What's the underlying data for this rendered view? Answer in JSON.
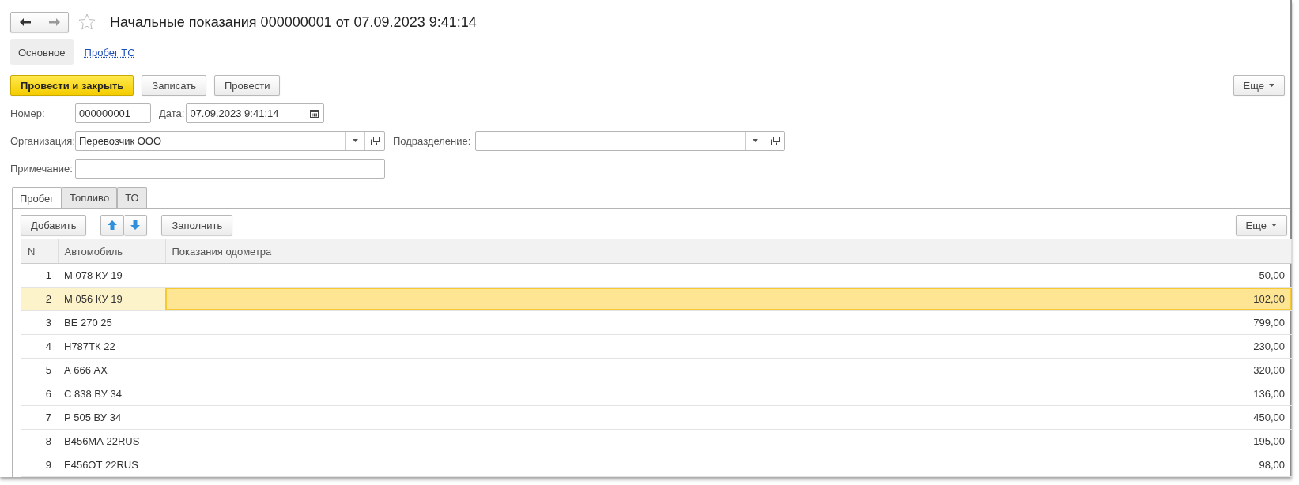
{
  "window": {
    "title": "Начальные показания 000000001 от 07.09.2023 9:41:14",
    "favorite": false
  },
  "sections": [
    {
      "label": "Основное",
      "selected": true
    },
    {
      "label": "Пробег ТС",
      "selected": false
    }
  ],
  "commands": [
    {
      "label": "Провести и закрыть",
      "kind": "primary"
    },
    {
      "label": "Записать",
      "kind": "normal"
    },
    {
      "label": "Провести",
      "kind": "normal"
    }
  ],
  "more_button": "Еще",
  "fields": {
    "number": {
      "label": "Номер:",
      "value": "000000001"
    },
    "date": {
      "label": "Дата:",
      "value": "07.09.2023  9:41:14"
    },
    "organization": {
      "label": "Организация:",
      "value": "Перевозчик ООО"
    },
    "subdivision": {
      "label": "Подразделение:"
    },
    "note": {
      "label": "Примечание:"
    }
  },
  "tabs": [
    {
      "label": "Пробег",
      "selected": true
    },
    {
      "label": "Топливо",
      "selected": false
    },
    {
      "label": "ТО",
      "selected": false
    }
  ],
  "table_toolbar": {
    "add": "Добавить",
    "fill": "Заполнить",
    "more": "Еще"
  },
  "table": {
    "columns": [
      "N",
      "Автомобиль",
      "Показания одометра"
    ],
    "rows": [
      {
        "n": "1",
        "car": "М 078 КУ 19",
        "odometer": "50,00",
        "selected": false
      },
      {
        "n": "2",
        "car": "М 056 КУ 19",
        "odometer": "102,00",
        "selected": true
      },
      {
        "n": "3",
        "car": "ВЕ 270 25",
        "odometer": "799,00",
        "selected": false
      },
      {
        "n": "4",
        "car": "Н787ТК 22",
        "odometer": "230,00",
        "selected": false
      },
      {
        "n": "5",
        "car": "А 666 АХ",
        "odometer": "320,00",
        "selected": false
      },
      {
        "n": "6",
        "car": "С 838 ВУ 34",
        "odometer": "136,00",
        "selected": false
      },
      {
        "n": "7",
        "car": "Р 505 ВУ 34",
        "odometer": "450,00",
        "selected": false
      },
      {
        "n": "8",
        "car": "В456МА 22RUS",
        "odometer": "195,00",
        "selected": false
      },
      {
        "n": "9",
        "car": "Е456ОТ 22RUS",
        "odometer": "98,00",
        "selected": false
      }
    ]
  }
}
